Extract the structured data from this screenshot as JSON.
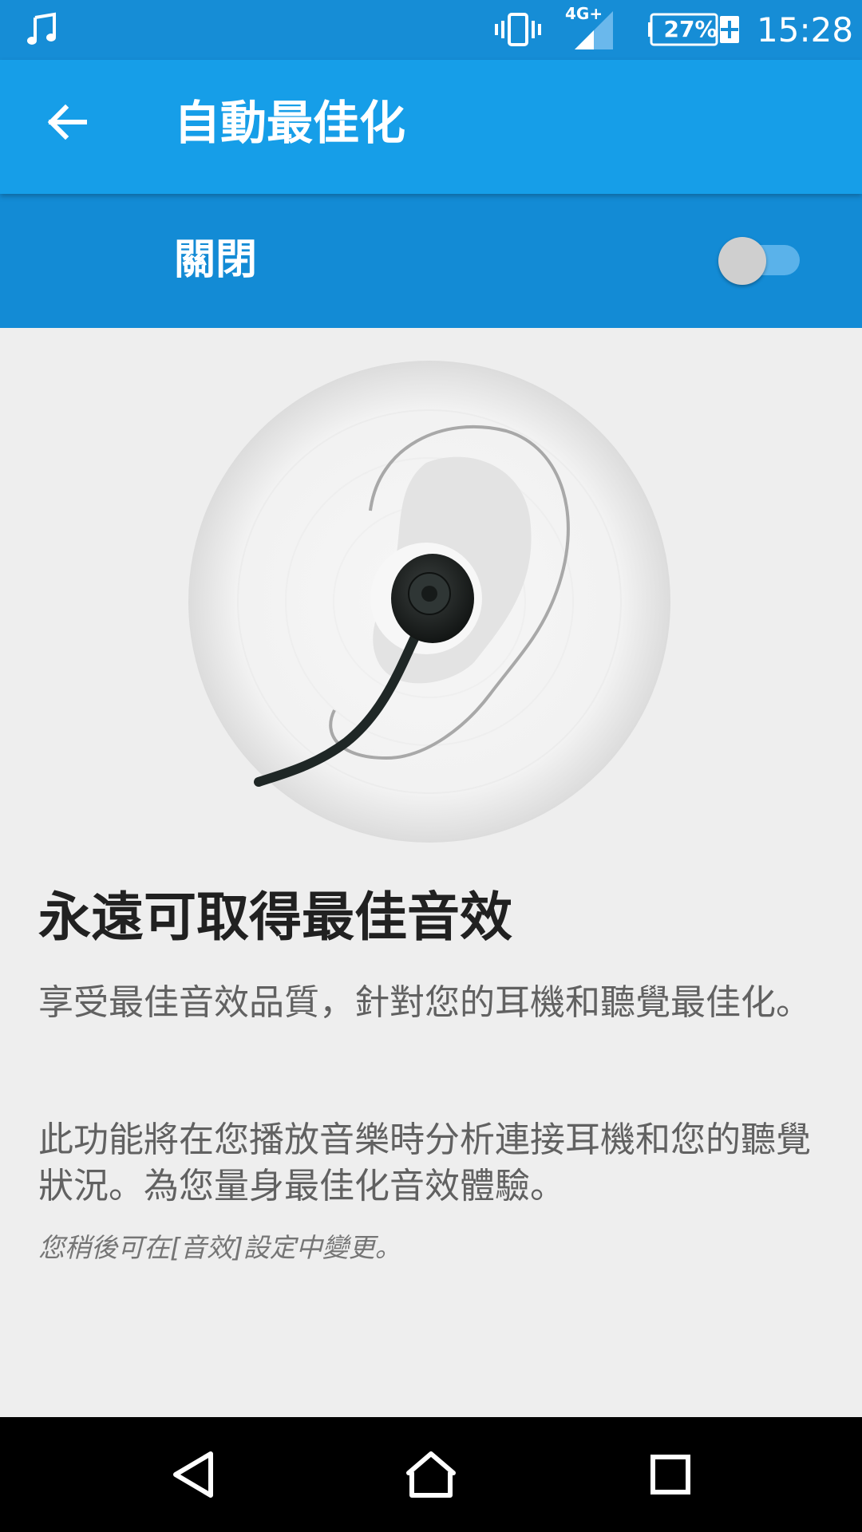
{
  "status_bar": {
    "music_icon": "music-note-icon",
    "vibrate_icon": "vibrate-icon",
    "network_type": "4G+",
    "signal_icon": "signal-icon",
    "battery_percent": "27%",
    "battery_icon": "battery-charging-icon",
    "time": "15:28"
  },
  "app_bar": {
    "back_icon": "arrow-back-icon",
    "title": "自動最佳化"
  },
  "toggle": {
    "label": "關閉",
    "state": "off"
  },
  "content": {
    "heading": "永遠可取得最佳音效",
    "paragraph_1": "享受最佳音效品質，針對您的耳機和聽覺最佳化。",
    "paragraph_2": "此功能將在您播放音樂時分析連接耳機和您的聽覺狀況。為您量身最佳化音效體驗。",
    "note": "您稍後可在[音效]設定中變更。"
  },
  "nav_bar": {
    "back_icon": "nav-back-icon",
    "home_icon": "nav-home-icon",
    "recents_icon": "nav-recents-icon"
  },
  "colors": {
    "status_bar": "#168dd6",
    "app_bar": "#169ee8",
    "toggle_bar": "#138bd5",
    "background": "#eeeeee"
  }
}
